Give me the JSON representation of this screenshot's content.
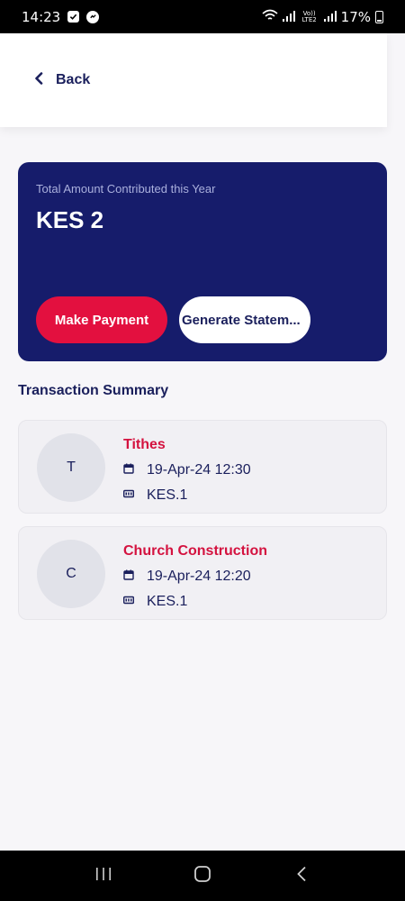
{
  "status_bar": {
    "time": "14:23",
    "lte_label": "Vo)) LTE2",
    "battery": "17%"
  },
  "header": {
    "back_label": "Back"
  },
  "summary": {
    "label": "Total Amount Contributed this Year",
    "amount": "KES 2",
    "make_payment_label": "Make Payment",
    "generate_statement_label": "Generate Statem..."
  },
  "transactions_title": "Transaction Summary",
  "transactions": [
    {
      "initial": "T",
      "title": "Tithes",
      "date": "19-Apr-24 12:30",
      "amount": "KES.1"
    },
    {
      "initial": "C",
      "title": "Church Construction",
      "date": "19-Apr-24 12:20",
      "amount": "KES.1"
    }
  ],
  "colors": {
    "primary": "#161c6b",
    "accent": "#e3103f",
    "text_dark": "#1a1f5c"
  }
}
